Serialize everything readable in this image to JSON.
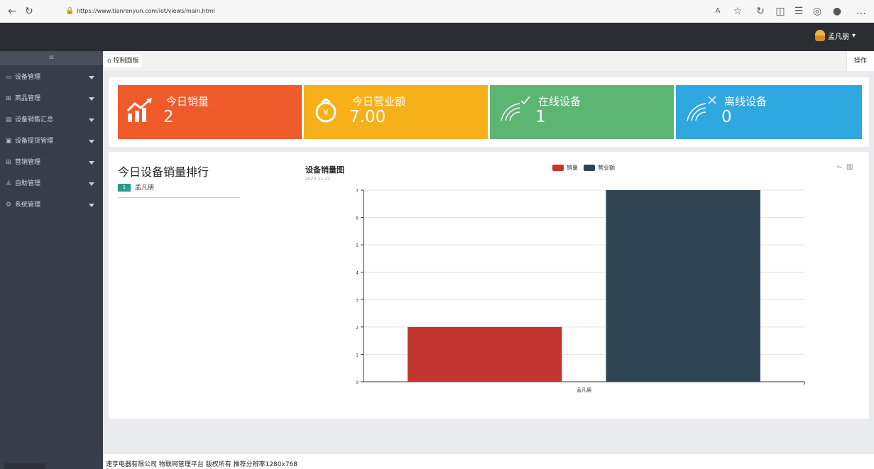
{
  "browser": {
    "url": "https://www.tianrenyun.com/iot/views/main.html"
  },
  "header": {
    "user_name": "孟凡朋"
  },
  "sidebar": {
    "toggle_icon": "≡",
    "items": [
      {
        "label": "设备管理",
        "icon": "monitor-icon"
      },
      {
        "label": "商品管理",
        "icon": "grid-icon"
      },
      {
        "label": "设备销售汇总",
        "icon": "doc-icon"
      },
      {
        "label": "设备提货管理",
        "icon": "box-icon"
      },
      {
        "label": "营销管理",
        "icon": "grid-icon"
      },
      {
        "label": "自助管理",
        "icon": "users-icon"
      },
      {
        "label": "系统管理",
        "icon": "gear-icon"
      }
    ]
  },
  "breadcrumb": {
    "label": "控制面板",
    "ops_label": "操作"
  },
  "stats": [
    {
      "title": "今日销量",
      "value": "2",
      "color": "#ee5a2a",
      "icon": "bar-chart-up-icon"
    },
    {
      "title": "今日营业额",
      "value": "7.00",
      "color": "#f5b01a",
      "icon": "yuan-bag-icon"
    },
    {
      "title": "在线设备",
      "value": "1",
      "color": "#5db574",
      "icon": "signal-online-icon"
    },
    {
      "title": "离线设备",
      "value": "0",
      "color": "#2fa7df",
      "icon": "signal-offline-icon"
    }
  ],
  "ranking": {
    "title": "今日设备销量排行",
    "rank": "1",
    "name": "孟凡朋"
  },
  "chart_data": {
    "type": "bar",
    "title": "设备销量图",
    "subtitle": "2023-11-27",
    "categories": [
      "孟凡朋"
    ],
    "series": [
      {
        "name": "销量",
        "values": [
          2
        ],
        "color": "#c23531"
      },
      {
        "name": "营业额",
        "values": [
          7
        ],
        "color": "#2f4554"
      }
    ],
    "ylim": [
      0,
      7
    ],
    "yticks": [
      0,
      1,
      2,
      3,
      4,
      5,
      6,
      7
    ],
    "grid": true,
    "legend": "top-center"
  },
  "footer": {
    "text": "速亨电器有限公司 物联网管理平台 版权所有 推荐分辨率1280x768"
  }
}
